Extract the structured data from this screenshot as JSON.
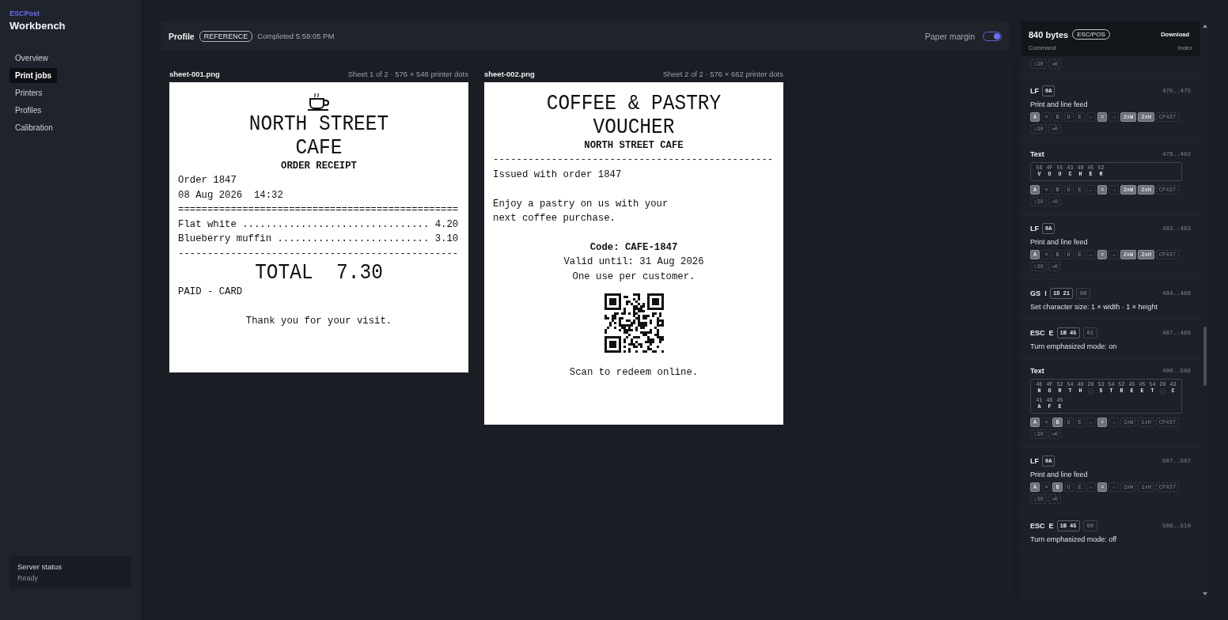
{
  "sidebar": {
    "brand": "ESCPost",
    "title": "Workbench",
    "items": [
      {
        "label": "Overview",
        "selected": false
      },
      {
        "label": "Print jobs",
        "selected": true
      },
      {
        "label": "Printers",
        "selected": false
      },
      {
        "label": "Profiles",
        "selected": false
      },
      {
        "label": "Calibration",
        "selected": false
      }
    ],
    "status": {
      "label": "Server status",
      "value": "Ready"
    }
  },
  "job_header": {
    "title": "Profile",
    "badge": "REFERENCE",
    "completed": "Completed 5:59:05 PM",
    "toggle": {
      "label": "Paper margin",
      "on": true
    }
  },
  "sheets": [
    {
      "name": "sheet-001.png",
      "info": "Sheet 1 of 2 · 576 × 548 printer dots",
      "lines": [
        {
          "kind": "icon"
        },
        {
          "kind": "big",
          "text": "NORTH STREET"
        },
        {
          "kind": "big",
          "text": "CAFE"
        },
        {
          "kind": "bold",
          "text": "ORDER RECEIPT"
        },
        {
          "kind": "text",
          "text": "Order 1847"
        },
        {
          "kind": "text",
          "text": "08 Aug 2026  14:32"
        },
        {
          "kind": "text",
          "text": "================================================"
        },
        {
          "kind": "text",
          "text": "Flat white ................................ 4.20"
        },
        {
          "kind": "text",
          "text": "Blueberry muffin .......................... 3.10"
        },
        {
          "kind": "text",
          "text": "------------------------------------------------"
        },
        {
          "kind": "big",
          "text": "TOTAL  7.30"
        },
        {
          "kind": "text",
          "text": "PAID - CARD"
        },
        {
          "kind": "gap"
        },
        {
          "kind": "center",
          "text": "Thank you for your visit."
        }
      ]
    },
    {
      "name": "sheet-002.png",
      "info": "Sheet 2 of 2 · 576 × 662 printer dots",
      "lines": [
        {
          "kind": "big",
          "text": "COFFEE & PASTRY"
        },
        {
          "kind": "big",
          "text": "VOUCHER"
        },
        {
          "kind": "bold",
          "text": "NORTH STREET CAFE"
        },
        {
          "kind": "text",
          "text": "------------------------------------------------"
        },
        {
          "kind": "text",
          "text": "Issued with order 1847"
        },
        {
          "kind": "gap"
        },
        {
          "kind": "text",
          "text": "Enjoy a pastry on us with your"
        },
        {
          "kind": "text",
          "text": "next coffee purchase."
        },
        {
          "kind": "gap"
        },
        {
          "kind": "bold",
          "text": "Code: CAFE-1847"
        },
        {
          "kind": "center",
          "text": "Valid until: 31 Aug 2026"
        },
        {
          "kind": "center",
          "text": "One use per customer."
        },
        {
          "kind": "qr"
        },
        {
          "kind": "center",
          "text": "Scan to redeem online."
        }
      ]
    }
  ],
  "command_panel": {
    "size": "840 bytes",
    "format": "ESC/POS",
    "download": "Download",
    "column_1": "Command",
    "column_2": "Index",
    "commands": [
      {
        "kind": "partial",
        "flags": [
          {
            "label": "↕30",
            "on": false,
            "disabled": true
          },
          {
            "label": "⇥0",
            "on": false,
            "disabled": true
          }
        ]
      },
      {
        "kind": "command",
        "name": "LF",
        "bytes": "0A",
        "range": "475..475",
        "description": "Print and line feed",
        "flags": [
          {
            "label": "A",
            "on": true,
            "disabled": false
          },
          {
            "label": "≡",
            "on": false,
            "disabled": false
          },
          {
            "label": "B",
            "on": false,
            "disabled": false
          },
          {
            "label": "U",
            "on": false,
            "disabled": false
          },
          {
            "label": "E",
            "on": false,
            "disabled": false
          },
          {
            "label": "←",
            "on": false,
            "disabled": false
          },
          {
            "label": "=",
            "on": true,
            "disabled": false
          },
          {
            "label": "→",
            "on": false,
            "disabled": false
          },
          {
            "label": "2xW",
            "on": true,
            "disabled": false
          },
          {
            "label": "2xH",
            "on": true,
            "disabled": false
          },
          {
            "label": "CP437",
            "on": false,
            "disabled": true
          },
          {
            "label": "↕30",
            "on": false,
            "disabled": true
          },
          {
            "label": "⇥0",
            "on": false,
            "disabled": true
          }
        ]
      },
      {
        "kind": "text",
        "name": "Text",
        "range": "476..482",
        "hex": [
          {
            "hex": "56",
            "char": "V"
          },
          {
            "hex": "4F",
            "char": "O"
          },
          {
            "hex": "55",
            "char": "U"
          },
          {
            "hex": "43",
            "char": "C"
          },
          {
            "hex": "48",
            "char": "H"
          },
          {
            "hex": "45",
            "char": "E"
          },
          {
            "hex": "52",
            "char": "R"
          }
        ],
        "flags": [
          {
            "label": "A",
            "on": true,
            "disabled": false
          },
          {
            "label": "≡",
            "on": false,
            "disabled": false
          },
          {
            "label": "B",
            "on": false,
            "disabled": false
          },
          {
            "label": "U",
            "on": false,
            "disabled": false
          },
          {
            "label": "E",
            "on": false,
            "disabled": false
          },
          {
            "label": "←",
            "on": false,
            "disabled": false
          },
          {
            "label": "=",
            "on": true,
            "disabled": false
          },
          {
            "label": "→",
            "on": false,
            "disabled": false
          },
          {
            "label": "2xW",
            "on": true,
            "disabled": false
          },
          {
            "label": "2xH",
            "on": true,
            "disabled": false
          },
          {
            "label": "CP437",
            "on": false,
            "disabled": true
          },
          {
            "label": "↕30",
            "on": false,
            "disabled": true
          },
          {
            "label": "⇥0",
            "on": false,
            "disabled": true
          }
        ]
      },
      {
        "kind": "command",
        "name": "LF",
        "bytes": "0A",
        "range": "483..483",
        "description": "Print and line feed",
        "flags": [
          {
            "label": "A",
            "on": true,
            "disabled": false
          },
          {
            "label": "≡",
            "on": false,
            "disabled": false
          },
          {
            "label": "B",
            "on": false,
            "disabled": false
          },
          {
            "label": "U",
            "on": false,
            "disabled": false
          },
          {
            "label": "E",
            "on": false,
            "disabled": false
          },
          {
            "label": "←",
            "on": false,
            "disabled": false
          },
          {
            "label": "=",
            "on": true,
            "disabled": false
          },
          {
            "label": "→",
            "on": false,
            "disabled": false
          },
          {
            "label": "2xW",
            "on": true,
            "disabled": false
          },
          {
            "label": "2xH",
            "on": true,
            "disabled": false
          },
          {
            "label": "CP437",
            "on": false,
            "disabled": true
          },
          {
            "label": "↕30",
            "on": false,
            "disabled": true
          },
          {
            "label": "⇥0",
            "on": false,
            "disabled": true
          }
        ]
      },
      {
        "kind": "command",
        "name": "GS  !",
        "bytes": "1D 21",
        "params": "00",
        "range": "484..486",
        "description": "Set character size: 1 × width · 1 × height"
      },
      {
        "kind": "command",
        "name": "ESC  E",
        "bytes": "1B 45",
        "params": "01",
        "range": "487..489",
        "description": "Turn emphasized mode: on"
      },
      {
        "kind": "text",
        "name": "Text",
        "range": "490..506",
        "hex": [
          {
            "hex": "4E",
            "char": "N"
          },
          {
            "hex": "4F",
            "char": "O"
          },
          {
            "hex": "52",
            "char": "R"
          },
          {
            "hex": "54",
            "char": "T"
          },
          {
            "hex": "48",
            "char": "H"
          },
          {
            "hex": "20"
          },
          {
            "hex": "53",
            "char": "S"
          },
          {
            "hex": "54",
            "char": "T"
          },
          {
            "hex": "52",
            "char": "R"
          },
          {
            "hex": "45",
            "char": "E"
          },
          {
            "hex": "45",
            "char": "E"
          },
          {
            "hex": "54",
            "char": "T"
          },
          {
            "hex": "20"
          },
          {
            "hex": "43",
            "char": "C"
          },
          {
            "hex": "41",
            "char": "A"
          },
          {
            "hex": "46",
            "char": "F"
          },
          {
            "hex": "45",
            "char": "E"
          }
        ],
        "flags": [
          {
            "label": "A",
            "on": true,
            "disabled": false
          },
          {
            "label": "≡",
            "on": false,
            "disabled": false
          },
          {
            "label": "B",
            "on": true,
            "disabled": false
          },
          {
            "label": "U",
            "on": false,
            "disabled": false
          },
          {
            "label": "E",
            "on": false,
            "disabled": false
          },
          {
            "label": "←",
            "on": false,
            "disabled": false
          },
          {
            "label": "=",
            "on": true,
            "disabled": false
          },
          {
            "label": "→",
            "on": false,
            "disabled": false
          },
          {
            "label": "1xW",
            "on": false,
            "disabled": true
          },
          {
            "label": "1xH",
            "on": false,
            "disabled": true
          },
          {
            "label": "CP437",
            "on": false,
            "disabled": true
          },
          {
            "label": "↕30",
            "on": false,
            "disabled": true
          },
          {
            "label": "⇥0",
            "on": false,
            "disabled": true
          }
        ]
      },
      {
        "kind": "command",
        "name": "LF",
        "bytes": "0A",
        "range": "507..507",
        "description": "Print and line feed",
        "flags": [
          {
            "label": "A",
            "on": true,
            "disabled": false
          },
          {
            "label": "≡",
            "on": false,
            "disabled": false
          },
          {
            "label": "B",
            "on": true,
            "disabled": false
          },
          {
            "label": "U",
            "on": false,
            "disabled": false
          },
          {
            "label": "E",
            "on": false,
            "disabled": false
          },
          {
            "label": "←",
            "on": false,
            "disabled": false
          },
          {
            "label": "=",
            "on": true,
            "disabled": false
          },
          {
            "label": "→",
            "on": false,
            "disabled": false
          },
          {
            "label": "1xW",
            "on": false,
            "disabled": true
          },
          {
            "label": "1xH",
            "on": false,
            "disabled": true
          },
          {
            "label": "CP437",
            "on": false,
            "disabled": true
          },
          {
            "label": "↕30",
            "on": false,
            "disabled": true
          },
          {
            "label": "⇥0",
            "on": false,
            "disabled": true
          }
        ]
      },
      {
        "kind": "command",
        "name": "ESC  E",
        "bytes": "1B 45",
        "params": "00",
        "range": "508..510",
        "description": "Turn emphasized mode: off"
      }
    ]
  }
}
